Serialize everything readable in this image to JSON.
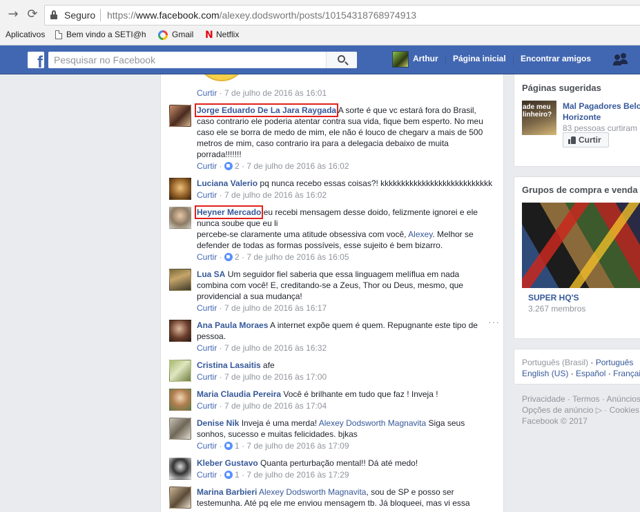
{
  "browser": {
    "secure_label": "Seguro",
    "url_prefix": "https://",
    "url_host": "www.facebook.com",
    "url_path": "/alexey.dodsworth/posts/10154318768974913",
    "bookmarks": [
      "Aplicativos",
      "Bem vindo a SETI@h",
      "Gmail",
      "Netflix"
    ]
  },
  "fb": {
    "search_placeholder": "Pesquisar no Facebook",
    "user_name": "Arthur",
    "nav_home": "Página inicial",
    "nav_find_friends": "Encontrar amigos",
    "brand_color": "#4267b2"
  },
  "comments": {
    "top_meta": {
      "action": "Curtir",
      "date": "7 de julho de 2016 às 16:01"
    },
    "items": [
      {
        "author": "Jorge Eduardo De La Jara Raygada",
        "lines": [
          "A sorte é que vc estará fora do Brasil,",
          "caso contrario ele poderia atentar contra sua vida, fique bem esperto. No meu",
          "caso ele se borra de medo de mim, ele não é louco de chegarv a mais de 500",
          "metros de mim, caso contrario ira para a delegacia debaixo de muita",
          "porrada!!!!!!!"
        ],
        "action": "Curtir",
        "likes": "2",
        "date": "7 de julho de 2016 às 16:02"
      },
      {
        "author": "Luciana Valerio",
        "lines": [
          "pq nunca recebo essas coisas?! kkkkkkkkkkkkkkkkkkkkkkkkkkk"
        ],
        "action": "Curtir",
        "date": "7 de julho de 2016 às 16:02"
      },
      {
        "author": "Heyner Mercado",
        "lines": [
          "eu recebi mensagem desse doido, felizmente ignorei e ele",
          "nunca soube que eu li"
        ],
        "line3_pre": "percebe-se claramente uma atitude obsessiva com você, ",
        "line3_mention": "Alexey",
        "line3_post": ". Melhor se",
        "line4": "defender de todas as formas possíveis, esse sujeito é bem bizarro.",
        "action": "Curtir",
        "likes": "2",
        "date": "7 de julho de 2016 às 16:05"
      },
      {
        "author": "Lua SA",
        "lines": [
          "Um seguidor fiel saberia que essa linguagem melíflua em nada",
          "combina com você! E, creditando-se a Zeus, Thor ou Deus, mesmo, que",
          "providencial a sua mudança!"
        ],
        "action": "Curtir",
        "date": "7 de julho de 2016 às 16:17"
      },
      {
        "author": "Ana Paula Moraes",
        "lines": [
          "A internet expõe quem é quem. Repugnante este tipo de",
          "pessoa."
        ],
        "action": "Curtir",
        "date": "7 de julho de 2016 às 16:32",
        "more": "···"
      },
      {
        "author": "Cristina Lasaitis",
        "lines": [
          "afe"
        ],
        "action": "Curtir",
        "date": "7 de julho de 2016 às 17:00"
      },
      {
        "author": "Maria Claudia Pereira",
        "lines": [
          "Você é brilhante em tudo que faz ! Inveja !"
        ],
        "action": "Curtir",
        "date": "7 de julho de 2016 às 17:04"
      },
      {
        "author": "Denise Nik",
        "line1_pre": "Inveja é uma merda! ",
        "line1_mention": "Alexey Dodsworth Magnavita",
        "line1_post": " Siga seus",
        "lines": [
          "sonhos, sucesso e muitas felicidades. bjkas"
        ],
        "action": "Curtir",
        "likes": "1",
        "date": "7 de julho de 2016 às 17:09"
      },
      {
        "author": "Kleber Gustavo",
        "lines": [
          "Quanta perturbação mental!! Dá até medo!"
        ],
        "action": "Curtir",
        "likes": "1",
        "date": "7 de julho de 2016 às 17:29"
      },
      {
        "author": "Marina Barbieri",
        "line1_mention": "Alexey Dodsworth Magnavita",
        "line1_post": ", sou de SP e posso ser",
        "lines": [
          "testemunha. Até pq ele me enviou mensagem tb. Já bloqueei, mas vi essa"
        ]
      }
    ]
  },
  "sidebar": {
    "pages_title": "Páginas sugeridas",
    "page_thumb_text": "ade meu\nlinheiro?",
    "page_name_1": "Mal Pagadores Belo",
    "page_name_2": "Horizonte",
    "page_likes": "83 pessoas curtiram",
    "page_like_btn": "Curtir",
    "groups_title": "Grupos de compra e venda",
    "group_name": "SUPER HQ'S",
    "group_members": "3.267 membros",
    "lang_1": "Português (Brasil)",
    "lang_2": "Português",
    "lang_3": "English (US)",
    "lang_4": "Español",
    "lang_5": "Françai",
    "footer_1": "Privacidade · Termos · Anúncios",
    "footer_2": "Opções de anúncio",
    "footer_2b": " · Cookies",
    "footer_3": "Facebook © 2017"
  }
}
